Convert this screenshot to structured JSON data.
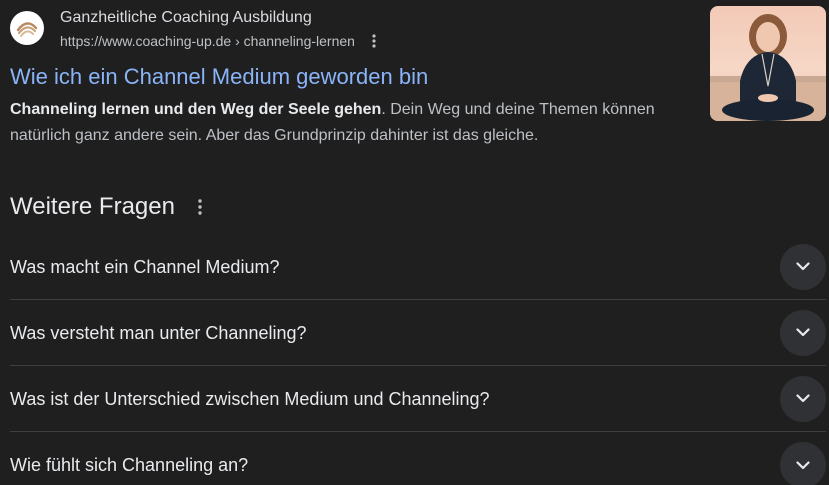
{
  "result": {
    "site_name": "Ganzheitliche Coaching Ausbildung",
    "url": "https://www.coaching-up.de › channeling-lernen",
    "title": "Wie ich ein Channel Medium geworden bin",
    "snippet_bold": "Channeling lernen und den Weg der Seele gehen",
    "snippet_rest": ". Dein Weg und deine Themen können natürlich ganz andere sein. Aber das Grundprinzip dahinter ist das gleiche.",
    "favicon": "spiral-logo-icon",
    "thumbnail": "woman-meditating-at-beach-photo"
  },
  "paa": {
    "title": "Weitere Fragen",
    "menu_icon": "more-vert-icon",
    "questions": [
      "Was macht ein Channel Medium?",
      "Was versteht man unter Channeling?",
      "Was ist der Unterschied zwischen Medium und Channeling?",
      "Wie fühlt sich Channeling an?"
    ],
    "expand_icon": "chevron-down-icon"
  },
  "colors": {
    "background": "#1f1f1f",
    "link": "#8ab4f8",
    "text": "#e8eaed",
    "muted": "#bdc1c6",
    "divider": "#3c4043",
    "button": "#303134"
  }
}
